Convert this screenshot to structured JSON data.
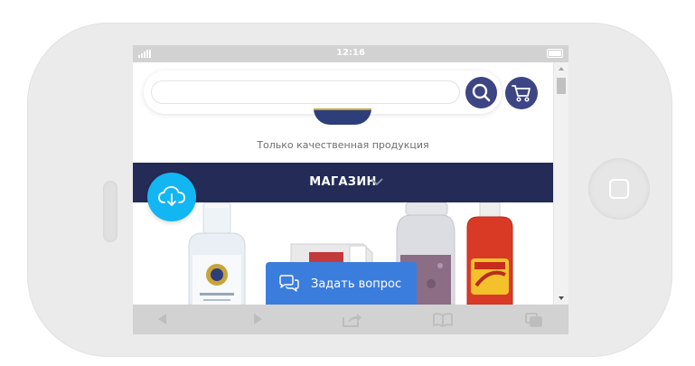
{
  "status_bar": {
    "time": "12:16"
  },
  "search": {
    "placeholder": "",
    "value": ""
  },
  "header": {
    "tagline": "Только качественная продукция"
  },
  "menu": {
    "label": "МАГАЗИН"
  },
  "chat": {
    "label": "Задать вопрос"
  },
  "toolbar": {
    "items": [
      "back",
      "forward",
      "share",
      "bookmarks",
      "tabs"
    ]
  },
  "colors": {
    "brand_navy": "#232b56",
    "button_indigo": "#3d4584",
    "cloud_blue": "#12b6f2",
    "chat_blue": "#3b7ddd"
  },
  "icons": {
    "search": "search-icon",
    "cart": "cart-icon",
    "cloud": "cloud-download-icon",
    "chat": "chat-bubbles-icon",
    "chevron": "chevron-down-icon"
  }
}
